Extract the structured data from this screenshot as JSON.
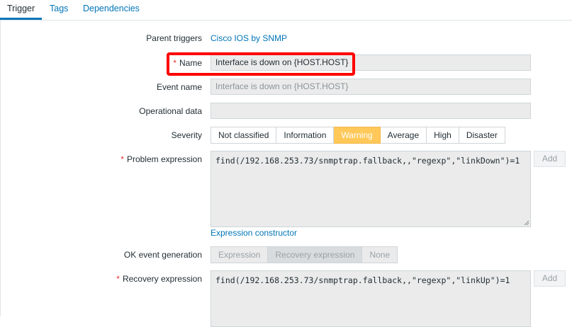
{
  "tabs": [
    {
      "label": "Trigger",
      "active": true
    },
    {
      "label": "Tags",
      "active": false
    },
    {
      "label": "Dependencies",
      "active": false
    }
  ],
  "form": {
    "parent_triggers": {
      "label": "Parent triggers",
      "value": "Cisco IOS by SNMP"
    },
    "name": {
      "label": "Name",
      "value": "Interface is down on {HOST.HOST}"
    },
    "event_name": {
      "label": "Event name",
      "placeholder": "Interface is down on {HOST.HOST}"
    },
    "operational_data": {
      "label": "Operational data",
      "value": ""
    },
    "severity": {
      "label": "Severity",
      "options": [
        "Not classified",
        "Information",
        "Warning",
        "Average",
        "High",
        "Disaster"
      ],
      "selected": "Warning"
    },
    "problem_expression": {
      "label": "Problem expression",
      "value": "find(/192.168.253.73/snmptrap.fallback,,\"regexp\",\"linkDown\")=1",
      "add_label": "Add",
      "constructor_link": "Expression constructor"
    },
    "ok_event_generation": {
      "label": "OK event generation",
      "options": [
        "Expression",
        "Recovery expression",
        "None"
      ],
      "selected": "Recovery expression"
    },
    "recovery_expression": {
      "label": "Recovery expression",
      "value": "find(/192.168.253.73/snmptrap.fallback,,\"regexp\",\"linkUp\")=1",
      "add_label": "Add"
    }
  },
  "colors": {
    "accent": "#0275b8",
    "warning": "#ffc859",
    "required": "#e33734",
    "highlight": "#ff0000"
  }
}
